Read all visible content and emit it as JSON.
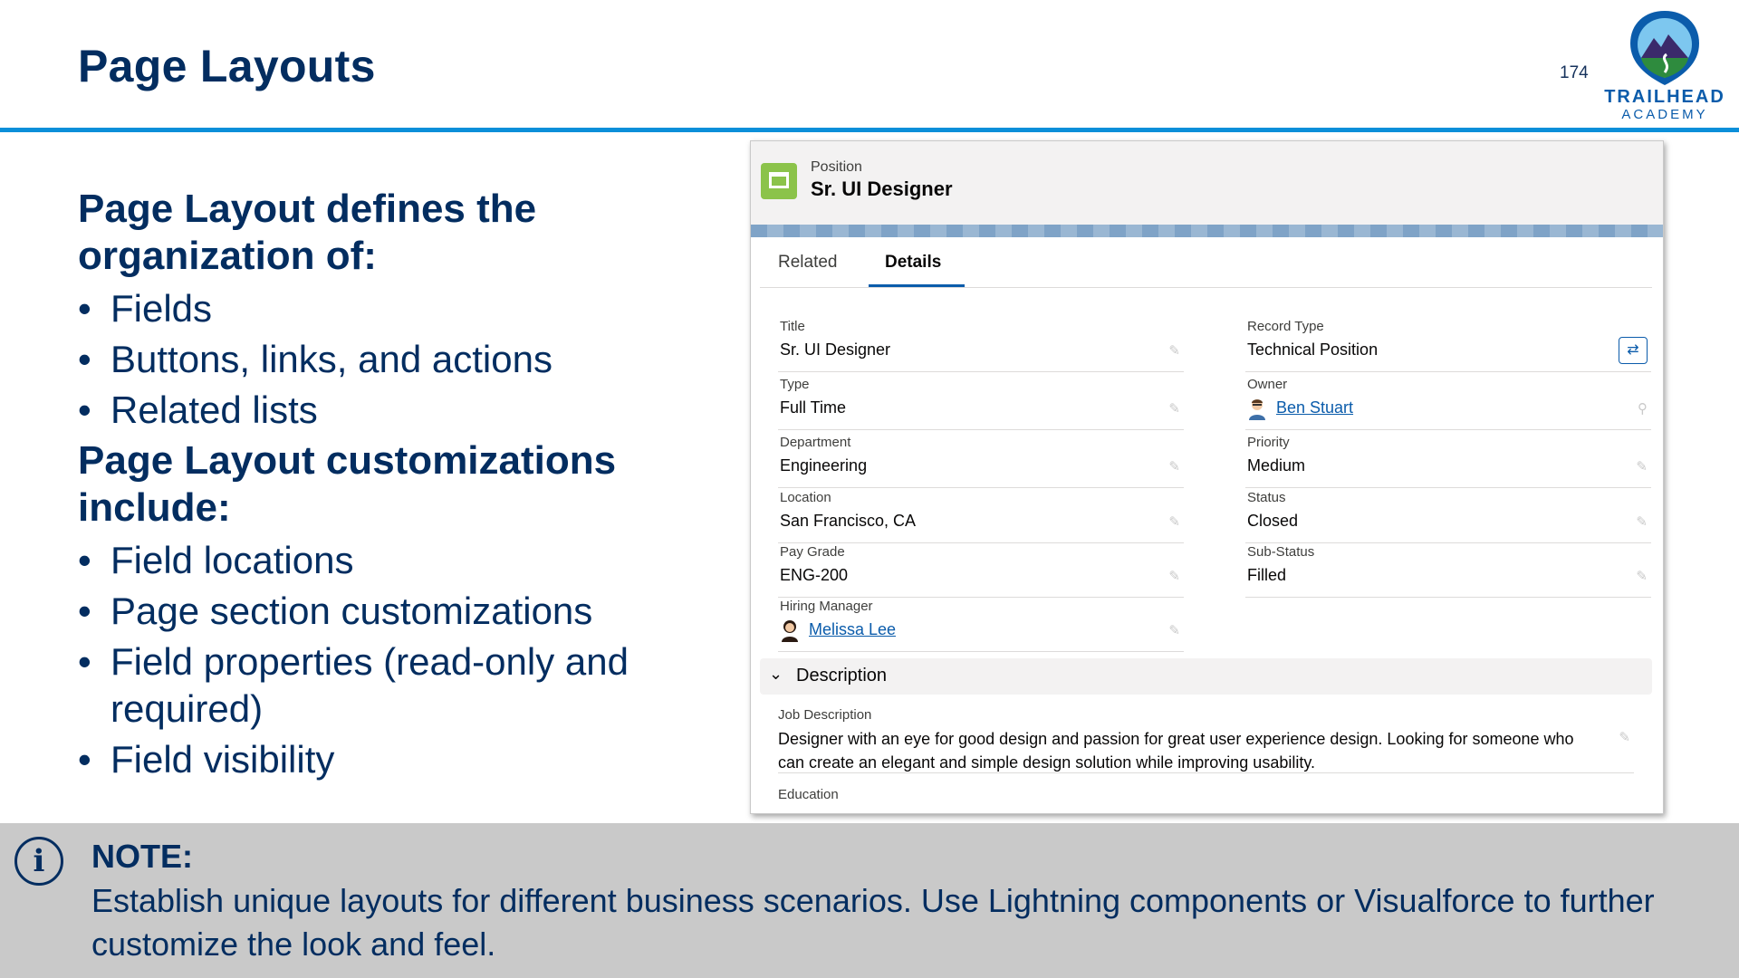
{
  "slide": {
    "title": "Page Layouts",
    "page_number": "174",
    "logo_line1": "TRAILHEAD",
    "logo_line2": "ACADEMY"
  },
  "content": {
    "heading1": "Page Layout defines the organization of:",
    "list1": [
      "Fields",
      "Buttons, links, and actions",
      "Related lists"
    ],
    "heading2": "Page Layout customizations include:",
    "list2": [
      "Field locations",
      "Page section customizations",
      "Field properties (read-only and required)",
      "Field visibility"
    ]
  },
  "record": {
    "object_label": "Position",
    "name": "Sr. UI Designer",
    "tabs": {
      "related": "Related",
      "details": "Details",
      "active": "Details"
    },
    "left_fields": [
      {
        "label": "Title",
        "value": "Sr. UI Designer"
      },
      {
        "label": "Type",
        "value": "Full Time"
      },
      {
        "label": "Department",
        "value": "Engineering"
      },
      {
        "label": "Location",
        "value": "San Francisco, CA"
      },
      {
        "label": "Pay Grade",
        "value": "ENG-200"
      },
      {
        "label": "Hiring Manager",
        "value": "Melissa Lee"
      }
    ],
    "right_fields": [
      {
        "label": "Record Type",
        "value": "Technical Position"
      },
      {
        "label": "Owner",
        "value": "Ben Stuart"
      },
      {
        "label": "Priority",
        "value": "Medium"
      },
      {
        "label": "Status",
        "value": "Closed"
      },
      {
        "label": "Sub-Status",
        "value": "Filled"
      }
    ],
    "section_title": "Description",
    "job_description_label": "Job Description",
    "job_description": "Designer with an eye for good design and passion for great user experience design. Looking for someone who can create an elegant and simple design solution while improving usability.",
    "education_label": "Education"
  },
  "note": {
    "title": "NOTE:",
    "text": "Establish unique layouts for different business scenarios.  Use Lightning components or Visualforce to further customize the look and feel."
  },
  "colors": {
    "navy": "#032D60",
    "accent_blue": "#0B8FD9",
    "link_blue": "#0B5CAB",
    "object_icon_green": "#8BC34A",
    "note_gray": "#C9C9C9"
  }
}
